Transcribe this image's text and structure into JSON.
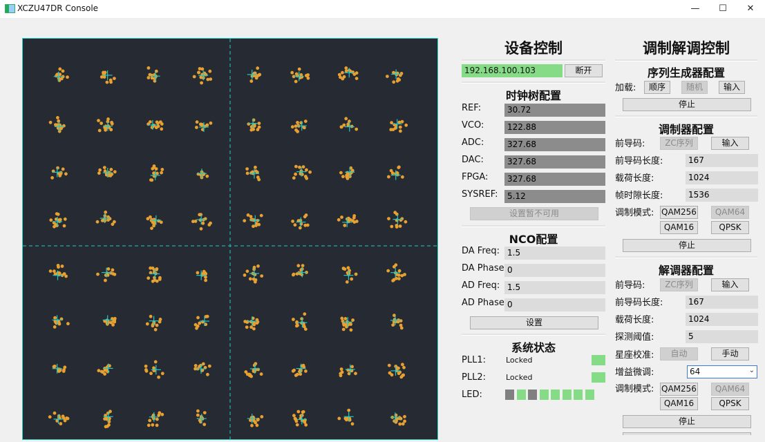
{
  "window": {
    "title": "XCZU47DR Console",
    "minimize": "—",
    "maximize": "☐",
    "close": "✕"
  },
  "device": {
    "title": "设备控制",
    "ip": "192.168.100.103",
    "disconnect": "断开",
    "clock": {
      "title": "时钟树配置",
      "rows": [
        {
          "label": "REF:",
          "value": "30.72"
        },
        {
          "label": "VCO:",
          "value": "122.88"
        },
        {
          "label": "ADC:",
          "value": "327.68"
        },
        {
          "label": "DAC:",
          "value": "327.68"
        },
        {
          "label": "FPGA:",
          "value": "327.68"
        },
        {
          "label": "SYSREF:",
          "value": "5.12"
        }
      ],
      "button": "设置暂不可用"
    },
    "nco": {
      "title": "NCO配置",
      "rows": [
        {
          "label": "DA Freq:",
          "value": "1.5"
        },
        {
          "label": "DA Phase:",
          "value": "0"
        },
        {
          "label": "AD Freq:",
          "value": "1.5"
        },
        {
          "label": "AD Phase:",
          "value": "0"
        }
      ],
      "button": "设置"
    },
    "status": {
      "title": "系统状态",
      "pll1_label": "PLL1:",
      "pll1_value": "Locked",
      "pll2_label": "PLL2:",
      "pll2_value": "Locked",
      "led_label": "LED:",
      "leds": [
        "off",
        "on",
        "off",
        "on",
        "on",
        "on",
        "on",
        "on"
      ],
      "colors": {
        "on": "#86dc86",
        "off": "#808080"
      }
    }
  },
  "modem": {
    "title": "调制解调控制",
    "seq": {
      "title": "序列生成器配置",
      "load_label": "加载:",
      "btn_order": "顺序",
      "btn_random": "随机",
      "btn_input": "输入",
      "stop": "停止"
    },
    "mod": {
      "title": "调制器配置",
      "preamble_label": "前导码:",
      "zc": "ZC序列",
      "input": "输入",
      "rows": [
        {
          "label": "前导码长度:",
          "value": "167"
        },
        {
          "label": "载荷长度:",
          "value": "1024"
        },
        {
          "label": "帧时隙长度:",
          "value": "1536"
        }
      ],
      "mode_label": "调制模式:",
      "qam256": "QAM256",
      "qam64": "QAM64",
      "qam16": "QAM16",
      "qpsk": "QPSK",
      "stop": "停止"
    },
    "demod": {
      "title": "解调器配置",
      "preamble_label": "前导码:",
      "zc": "ZC序列",
      "input": "输入",
      "rows": [
        {
          "label": "前导码长度:",
          "value": "167"
        },
        {
          "label": "载荷长度:",
          "value": "1024"
        },
        {
          "label": "探测阈值:",
          "value": "5"
        }
      ],
      "constellation_label": "星座校准:",
      "auto": "自动",
      "manual": "手动",
      "gain_label": "增益微调:",
      "gain_value": "64",
      "mode_label": "调制模式:",
      "qam256": "QAM256",
      "qam64": "QAM64",
      "qam16": "QAM16",
      "qpsk": "QPSK",
      "stop": "停止"
    }
  },
  "plot": {
    "point_color": "#e8a030",
    "cross_color": "#20c8c8",
    "grid_color": "#20c8c8",
    "bg": "#262a33"
  }
}
